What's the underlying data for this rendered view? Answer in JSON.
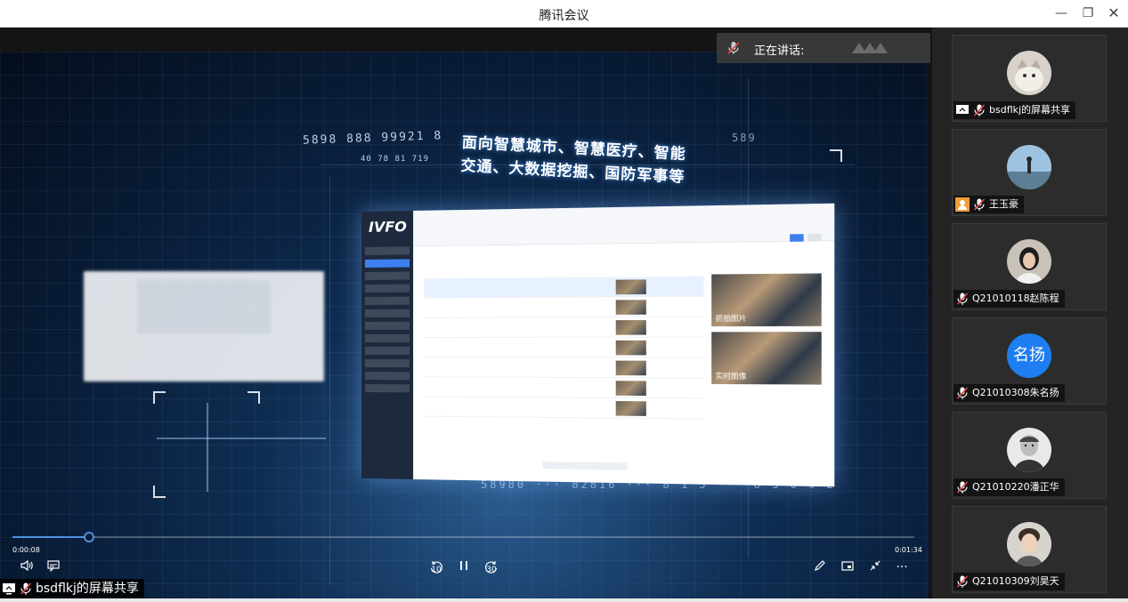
{
  "window": {
    "title": "腾讯会议",
    "minimize": "—",
    "maximize": "❐",
    "close": "✕"
  },
  "stage": {
    "back_label": "←",
    "speaking_label": "正在讲话:",
    "video": {
      "headline_line1": "面向智慧城市、智慧医疗、智能",
      "headline_line2": "交通、大数据挖掘、国防军事等",
      "digits_top": "5898 888 99921 8",
      "digits_bottom": "58980 ··· 82816 ··· 8 1 5 ··· 8 3 0 0 2",
      "digits_small": "40 78 81 719",
      "logo": "IVFO",
      "shot1_label": "抓拍图片",
      "shot2_label": "实时图像",
      "right_digit": "589"
    },
    "player": {
      "time_start": "0:00:08",
      "time_end": "0:01:34",
      "progress": 0.085,
      "volume_icon": "volume-icon",
      "caption_icon": "caption-icon",
      "rewind_label": "10",
      "pause_icon": "pause-icon",
      "forward_label": "30",
      "pen_icon": "pen-icon",
      "pip_icon": "pip-icon",
      "shrink_icon": "shrink-icon",
      "more_label": "···"
    },
    "share_label": "bsdflkj的屏幕共享"
  },
  "participants": [
    {
      "name": "bsdflkj的屏幕共享",
      "avatar": "cat-photo",
      "badge": "screen-share-icon"
    },
    {
      "name": "王玉豪",
      "avatar": "landscape-photo",
      "badge": "user-badge-icon"
    },
    {
      "name": "Q21010118赵陈程",
      "avatar": "person-photo",
      "badge": ""
    },
    {
      "name": "Q21010308朱名扬",
      "avatar": "text",
      "avatar_text": "名扬",
      "badge": ""
    },
    {
      "name": "Q21010220潘正华",
      "avatar": "portrait-sketch",
      "badge": ""
    },
    {
      "name": "Q21010309刘昊天",
      "avatar": "person-photo",
      "badge": ""
    }
  ],
  "colors": {
    "accent": "#4a90e2",
    "avatar_blue": "#1e7ef0",
    "mic_muted": "#e64545"
  }
}
